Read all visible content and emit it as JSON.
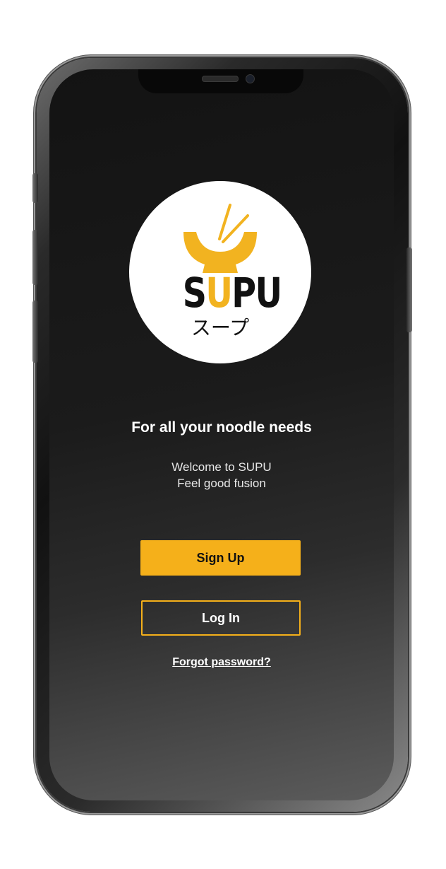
{
  "logo": {
    "brand_name": "SUPU",
    "brand_name_accent_letter": "U",
    "subtitle": "スープ",
    "accent_color": "#f2b320"
  },
  "headline": "For all your noodle needs",
  "welcome": {
    "line1": "Welcome to SUPU",
    "line2": "Feel good fusion"
  },
  "actions": {
    "signup_label": "Sign Up",
    "login_label": "Log In",
    "forgot_label": "Forgot password?"
  },
  "colors": {
    "primary": "#f5b01a",
    "background_top": "#131313",
    "background_bottom": "#5c5c5c",
    "text": "#ffffff"
  },
  "icons": [
    "noodle-bowl-icon",
    "chopsticks-icon"
  ]
}
